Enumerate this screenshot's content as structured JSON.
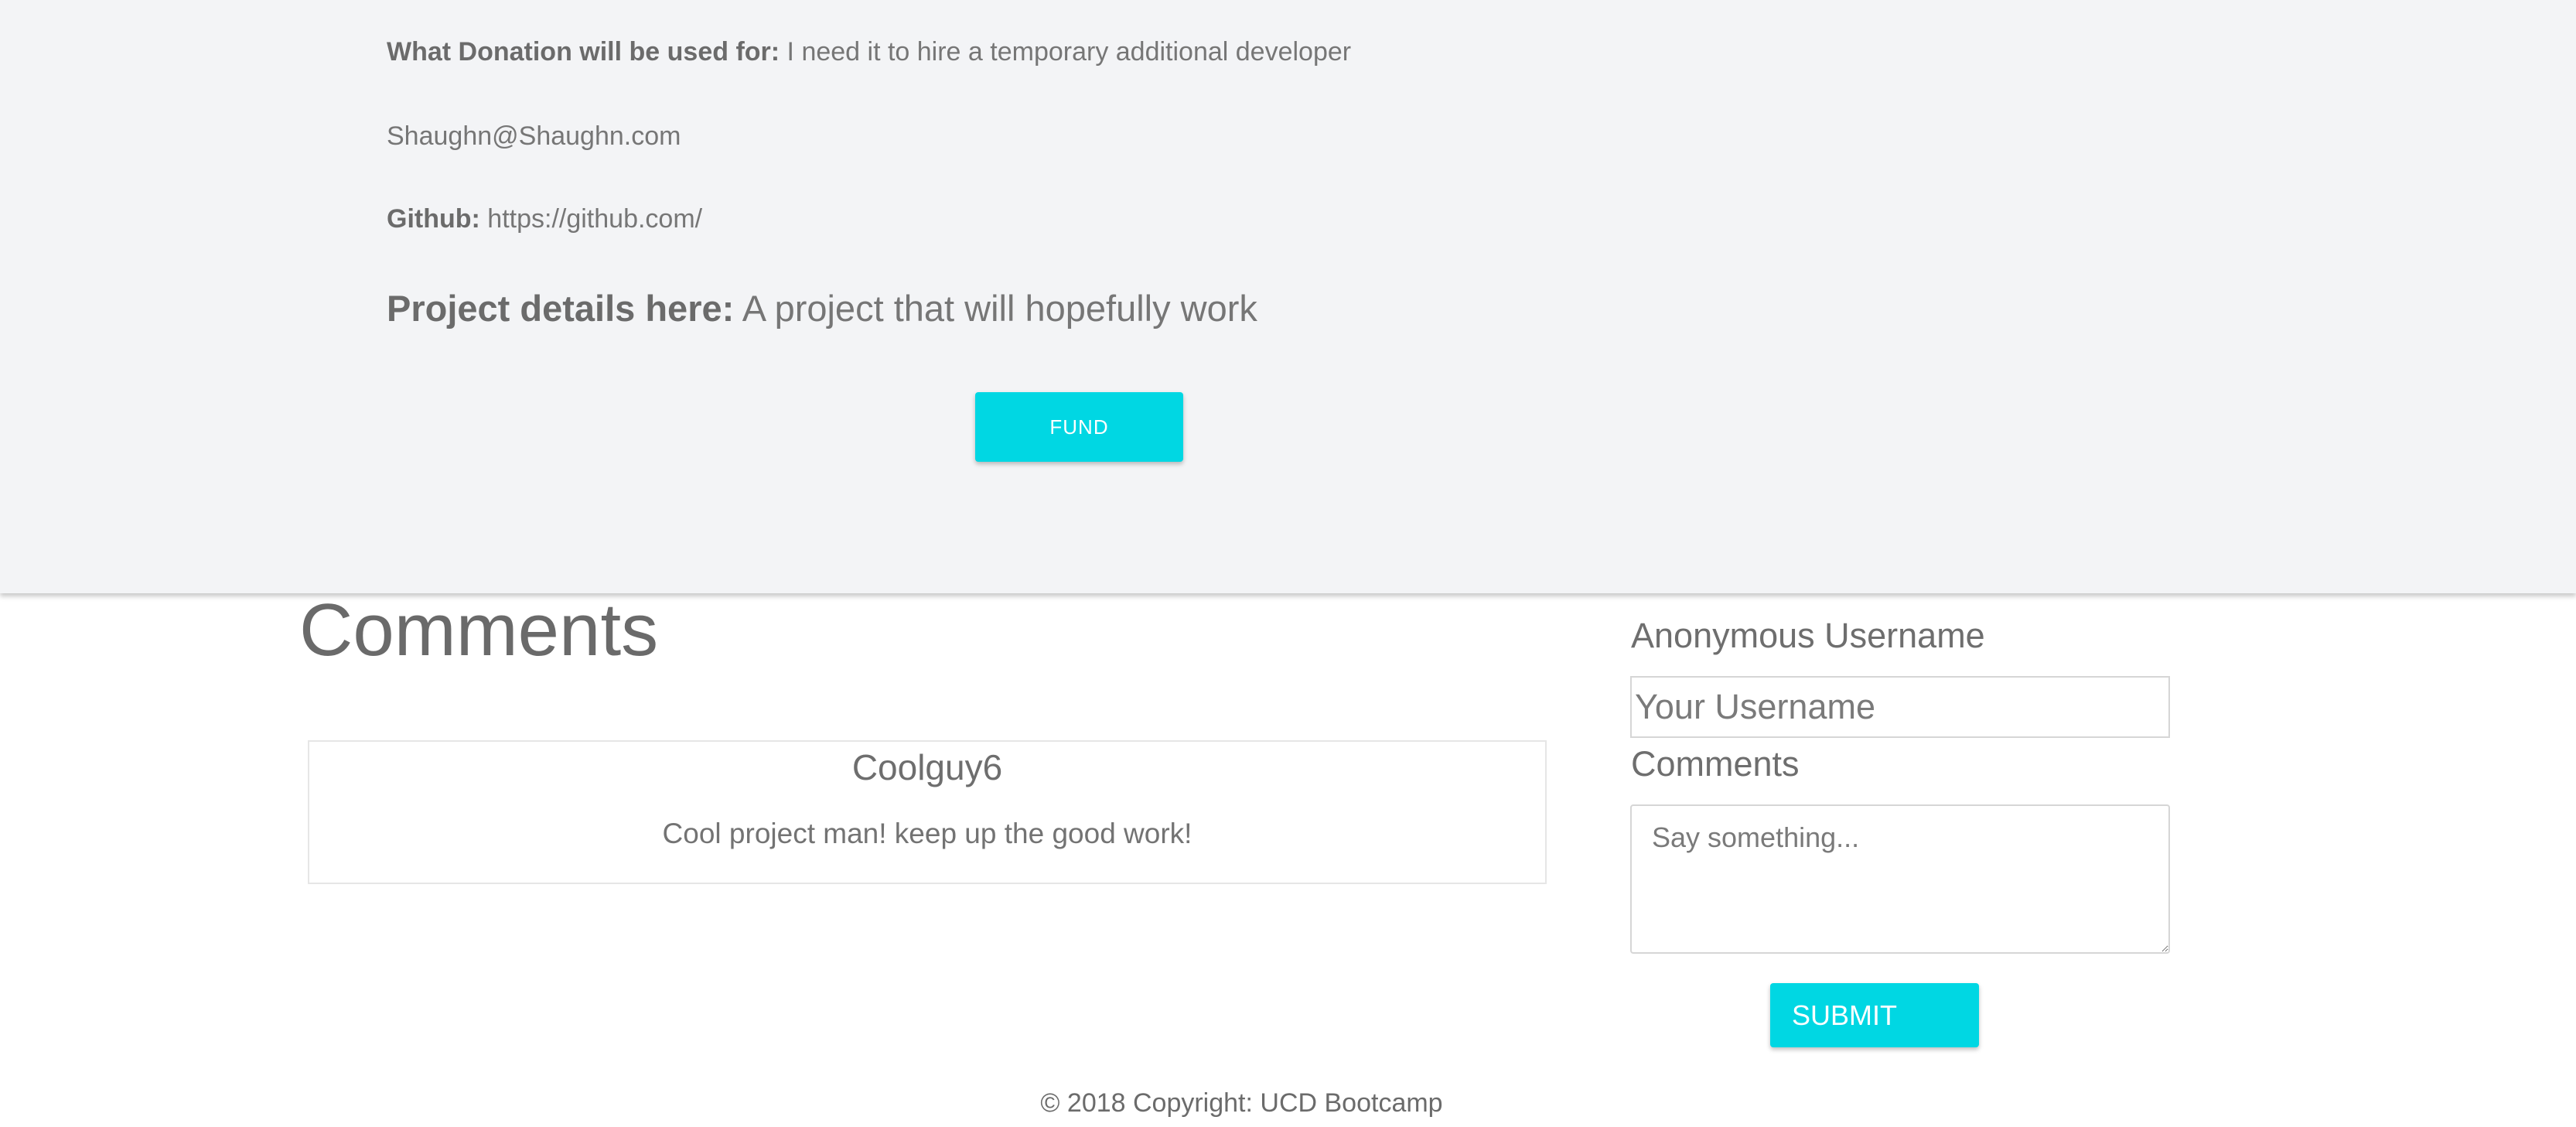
{
  "project": {
    "donation_label": "What Donation will be used for:",
    "donation_value": "I need it to hire a temporary additional developer",
    "email": "Shaughn@Shaughn.com",
    "github_label": "Github:",
    "github_value": "https://github.com/",
    "details_label": "Project details here:",
    "details_value": "A project that will hopefully work",
    "fund_label": "FUND"
  },
  "comments": {
    "title": "Comments",
    "items": [
      {
        "user": "Coolguy6",
        "text": "Cool project man! keep up the good work!"
      }
    ]
  },
  "form": {
    "username_label": "Anonymous Username",
    "username_placeholder": "Your Username",
    "comments_label": "Comments",
    "comments_placeholder": "Say something...",
    "submit_label": "SUBMIT"
  },
  "footer": {
    "copyright": "© 2018 Copyright: UCD Bootcamp"
  },
  "colors": {
    "accent": "#00d7e3",
    "panel_bg": "#f3f4f6",
    "text": "#757575"
  }
}
